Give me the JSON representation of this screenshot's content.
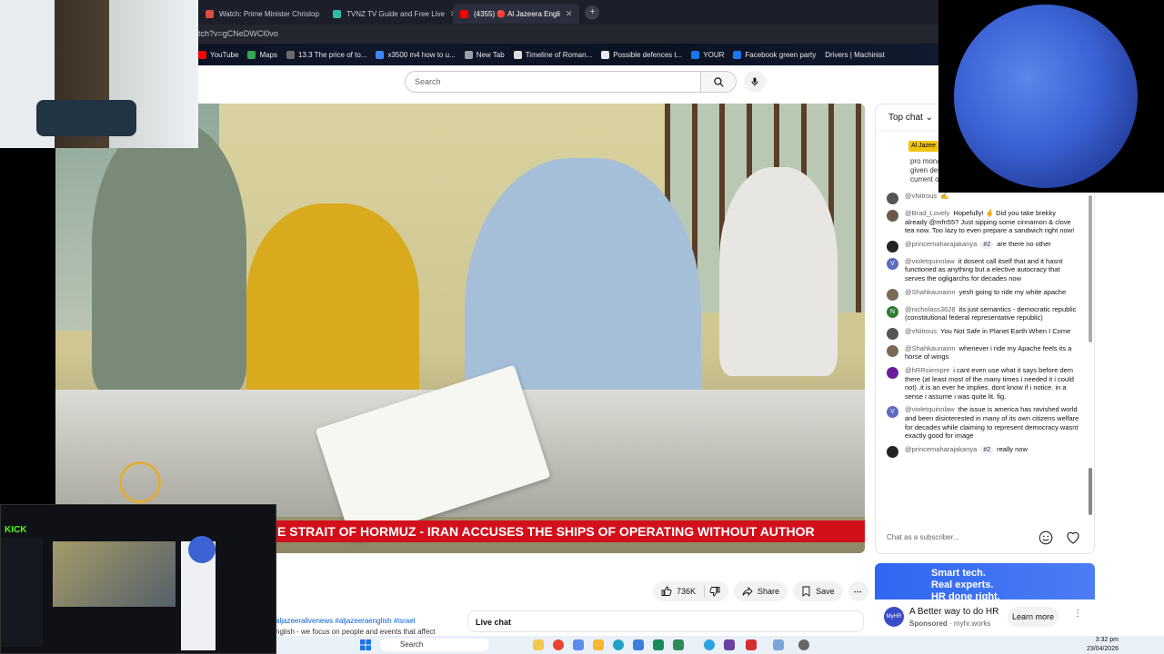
{
  "tabs": [
    {
      "label": "Watch: Prime Minister Christop",
      "color": "#e04b3f",
      "active": false
    },
    {
      "label": "TVNZ TV Guide and Free Live",
      "color": "#2dbfa6",
      "active": false
    },
    {
      "label": "(4355) 🔴 Al Jazeera Engli",
      "color": "#ff0000",
      "active": true
    }
  ],
  "url": "tch?v=gCNeDWCl0vo",
  "bookmarks": [
    {
      "label": "YouTube",
      "color": "#ff0000"
    },
    {
      "label": "Maps",
      "color": "#34a853"
    },
    {
      "label": "13.3 The price of to...",
      "color": "#6b6b6b"
    },
    {
      "label": "x3500 m4 how to u...",
      "color": "#4285f4"
    },
    {
      "label": "New Tab",
      "color": "#9aa0a6"
    },
    {
      "label": "Timeline of Roman...",
      "color": "#dddddd"
    },
    {
      "label": "Possible defences t...",
      "color": "#e8e8e8"
    },
    {
      "label": "YOUR",
      "color": "#1877f2"
    },
    {
      "label": "Facebook green party",
      "color": "#1877f2"
    },
    {
      "label": "Drivers | Machinist",
      "color": "#444444"
    }
  ],
  "search": {
    "placeholder": "Search"
  },
  "video": {
    "ticker": "E STRAIT OF HORMUZ   -   IRAN ACCUSES THE SHIPS OF OPERATING WITHOUT AUTHOR"
  },
  "actions": {
    "likes": "736K",
    "share": "Share",
    "save": "Save"
  },
  "description": {
    "tags": "aljazeeralivenews #aljazeeraenglish #israel",
    "text": "nglish - we focus on people and events that affect"
  },
  "livechat_bar": "Live chat",
  "chat": {
    "header": "Top chat",
    "pinned_badge": "Al Jazee",
    "pinned_text": "pro mona given der current o",
    "input_placeholder": "Chat as a subscriber...",
    "messages": [
      {
        "author": "@vNitrous",
        "text": "✍️",
        "member": "",
        "avatar": "#555555",
        "initial": ""
      },
      {
        "author": "@Brad_Lovely",
        "text": "Hopefully! 🤞 Did you take brekky already @mfn55? Just sipping some cinnamon & clove tea now. Too lazy to even prepare a sandwich right now!",
        "member": "",
        "avatar": "#6b5a4a",
        "initial": ""
      },
      {
        "author": "@princemaharajakanya",
        "text": "are there no other",
        "member": "#2",
        "avatar": "#222222",
        "initial": ""
      },
      {
        "author": "@violetquinnlaw",
        "text": "it dosent call itself that and it hasnt functioned as anything but a elective autocracy that serves the ogligarchs for decades now",
        "member": "",
        "avatar": "#5c6bc0",
        "initial": "V"
      },
      {
        "author": "@Shahkaunainn",
        "text": "yesh going to ride my white apache",
        "member": "",
        "avatar": "#7a6a55",
        "initial": ""
      },
      {
        "author": "@nicholass3628",
        "text": "its just semantics - democratic republic (constitutional federal representative republic)",
        "member": "",
        "avatar": "#2e7d32",
        "initial": "N"
      },
      {
        "author": "@vNitrous",
        "text": "You Not Safe in Planet Earth When I Come",
        "member": "",
        "avatar": "#555555",
        "initial": ""
      },
      {
        "author": "@Shahkaunainn",
        "text": "whenever i ride my Apache feels its a horse of wings",
        "member": "",
        "avatar": "#7a6a55",
        "initial": ""
      },
      {
        "author": "@hRRsiempre",
        "text": "i cant even use what it says before dem there (at least most of the many times i needed it i could not) ,it is an ever he implies. dont know if i notice. in a sense i assume i was quite lit. fig.",
        "member": "",
        "avatar": "#6a1b9a",
        "initial": ""
      },
      {
        "author": "@violetquinnlaw",
        "text": "the issue is america has ravished world and been disinterested in many of its own citizens welfare for decades while claiming to represent democracy wasnt exactly good for image",
        "member": "",
        "avatar": "#5c6bc0",
        "initial": "V"
      },
      {
        "author": "@princemaharajakanya",
        "text": "really now",
        "member": "#2",
        "avatar": "#222222",
        "initial": ""
      }
    ]
  },
  "ad": {
    "banner": "Smart tech.\nReal experts.\nHR done right.",
    "title": "A Better way to do HR",
    "sponsored": "Sponsored",
    "domain": "· myhr.works",
    "cta": "Learn more",
    "logo_text": "MyHR"
  },
  "pip": {
    "logo": "KICK"
  },
  "taskbar": {
    "search": "Search"
  },
  "clock": {
    "time": "3:32 pm",
    "date": "23/04/2026"
  }
}
